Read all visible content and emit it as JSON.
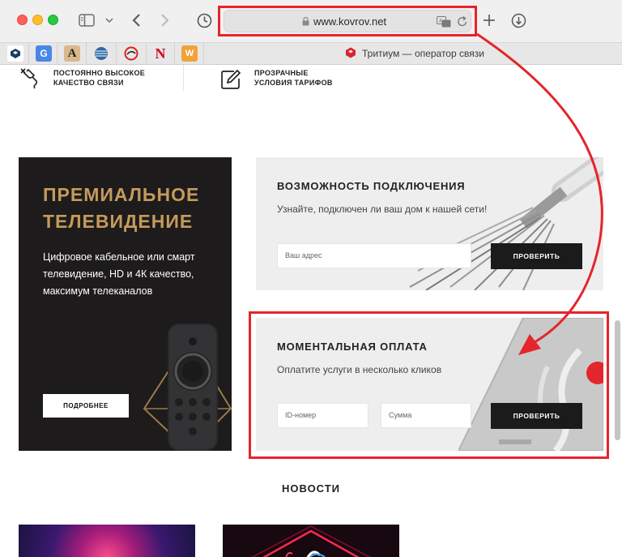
{
  "browser": {
    "url": "www.kovrov.net",
    "tab_title": "Тритиум — оператор связи",
    "bookmarks": [
      {
        "label": "",
        "color": "#1d3b63",
        "text_color": "#ffffff"
      },
      {
        "label": "G",
        "color": "#4a86e8",
        "text_color": "#ffffff"
      },
      {
        "label": "A",
        "color": "#d9b88c",
        "text_color": "#222222"
      },
      {
        "label": "",
        "color": "#2f6aa8",
        "text_color": "#ffffff"
      },
      {
        "label": "",
        "color": "#ffffff",
        "text_color": "#d22"
      },
      {
        "label": "N",
        "color": "#ffffff",
        "text_color": "#d0021b"
      },
      {
        "label": "W",
        "color": "#f2a23a",
        "text_color": "#ffffff"
      }
    ]
  },
  "features": [
    {
      "icon": "plug-icon",
      "label": "ПОСТОЯННО ВЫСОКОЕ КАЧЕСТВО СВЯЗИ"
    },
    {
      "icon": "edit-icon",
      "label": "ПРОЗРАЧНЫЕ УСЛОВИЯ ТАРИФОВ"
    }
  ],
  "tv": {
    "title": "ПРЕМИАЛЬНОЕ ТЕЛЕВИДЕНИЕ",
    "description": "Цифровое кабельное или смарт телевидение, HD и 4К качество, максимум телеканалов",
    "button": "ПОДРОБНЕЕ"
  },
  "connect": {
    "title": "ВОЗМОЖНОСТЬ ПОДКЛЮЧЕНИЯ",
    "subtitle": "Узнайте, подключен ли ваш дом к нашей сети!",
    "address_placeholder": "Ваш адрес",
    "button": "ПРОВЕРИТЬ"
  },
  "payment": {
    "title": "МОМЕНТАЛЬНАЯ ОПЛАТА",
    "subtitle": "Оплатите услуги в несколько кликов",
    "id_placeholder": "ID-номер",
    "amount_placeholder": "Сумма",
    "button": "ПРОВЕРИТЬ"
  },
  "news": {
    "title": "НОВОСТИ"
  },
  "colors": {
    "accent_gold": "#c59a5a",
    "highlight_red": "#e3262b",
    "dark": "#1c1b1c"
  }
}
